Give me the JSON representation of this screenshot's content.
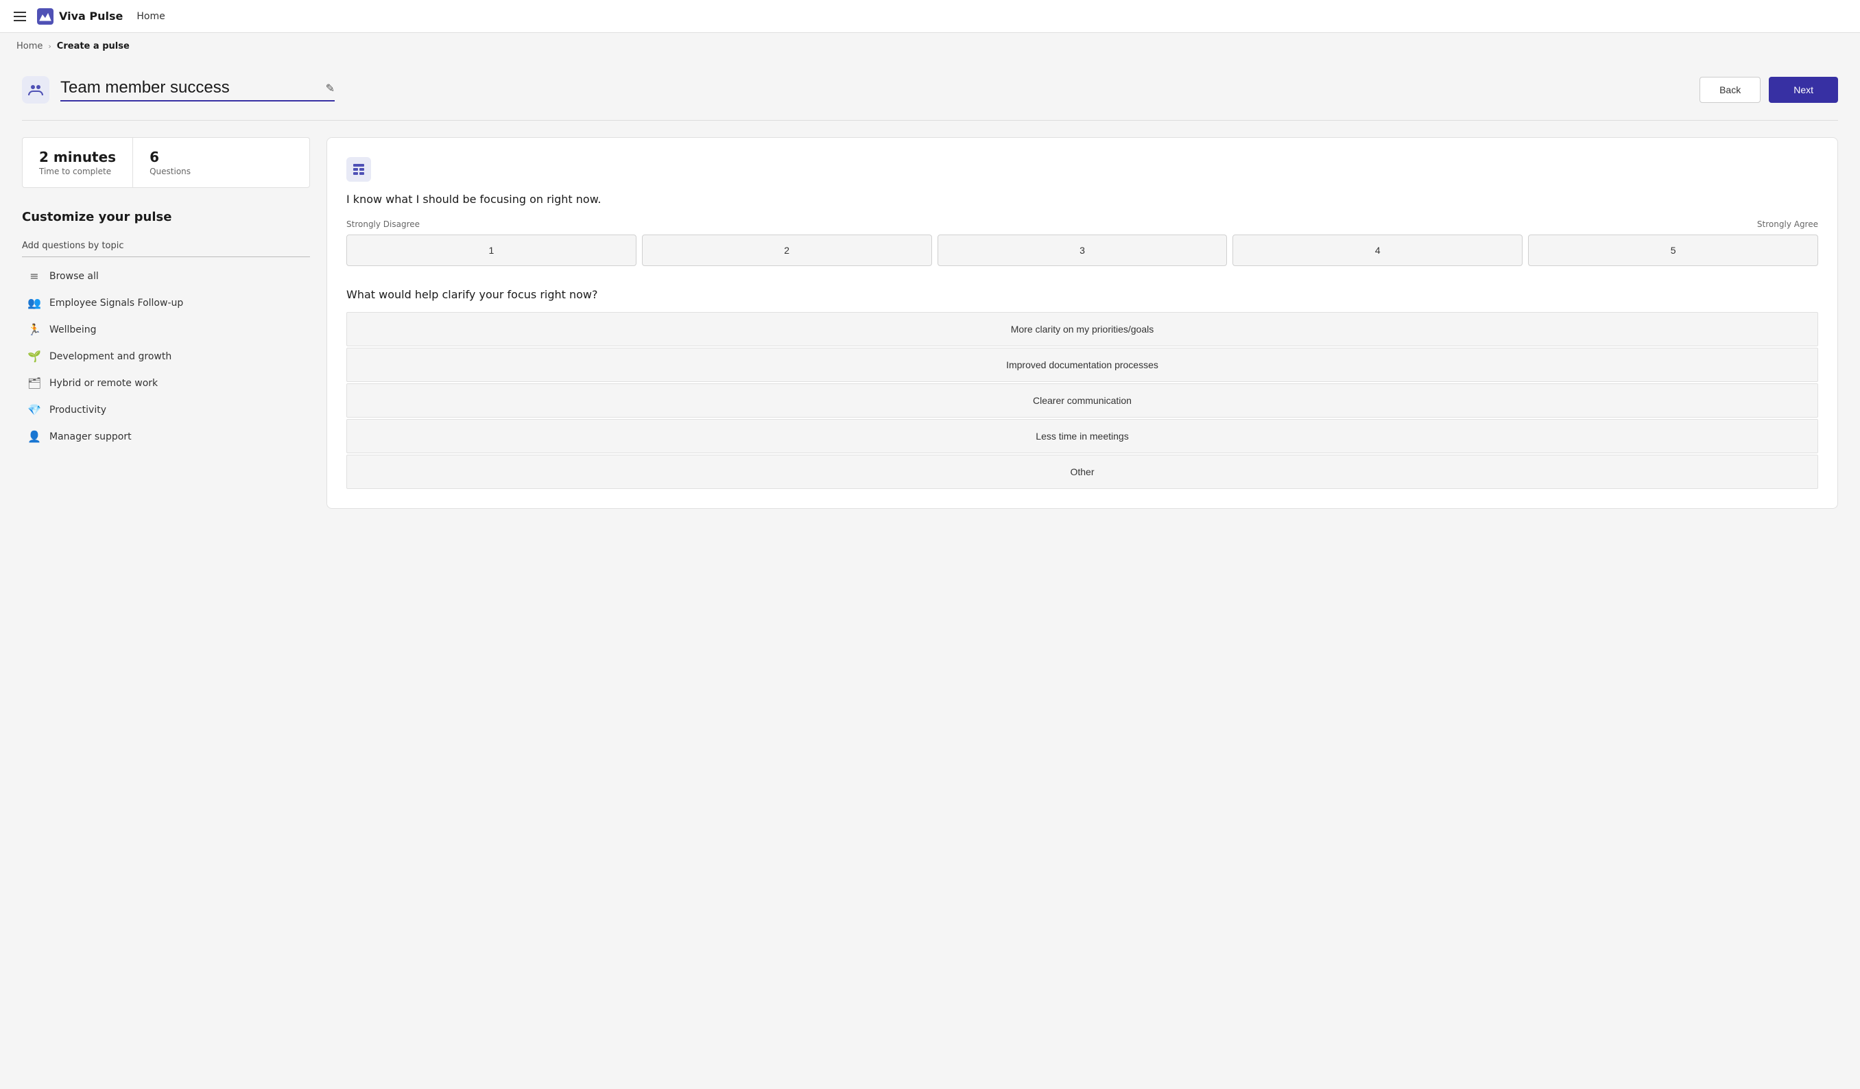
{
  "nav": {
    "menu_icon": "☰",
    "brand_name": "Viva Pulse",
    "nav_home": "Home"
  },
  "breadcrumb": {
    "home": "Home",
    "separator": "›",
    "current": "Create a pulse"
  },
  "header": {
    "pulse_title": "Team member success",
    "edit_icon": "✎",
    "back_label": "Back",
    "next_label": "Next"
  },
  "stats": {
    "time_value": "2 minutes",
    "time_label": "Time to complete",
    "questions_value": "6",
    "questions_label": "Questions"
  },
  "left_panel": {
    "customize_title": "Customize your pulse",
    "add_questions_label": "Add questions by topic",
    "topics": [
      {
        "id": "browse-all",
        "label": "Browse all",
        "icon": "≡"
      },
      {
        "id": "employee-signals",
        "label": "Employee Signals Follow-up",
        "icon": "👥"
      },
      {
        "id": "wellbeing",
        "label": "Wellbeing",
        "icon": "🏃"
      },
      {
        "id": "development",
        "label": "Development and growth",
        "icon": "🌱"
      },
      {
        "id": "hybrid-remote",
        "label": "Hybrid or remote work",
        "icon": "🗂"
      },
      {
        "id": "productivity",
        "label": "Productivity",
        "icon": "💎"
      },
      {
        "id": "manager-support",
        "label": "Manager support",
        "icon": "👤"
      }
    ]
  },
  "question_card": {
    "question1": "I know what I should be focusing on right now.",
    "scale_low": "Strongly Disagree",
    "scale_high": "Strongly Agree",
    "scale_options": [
      "1",
      "2",
      "3",
      "4",
      "5"
    ],
    "question2": "What would help clarify your focus right now?",
    "choices": [
      "More clarity on my priorities/goals",
      "Improved documentation processes",
      "Clearer communication",
      "Less time in meetings",
      "Other"
    ]
  }
}
